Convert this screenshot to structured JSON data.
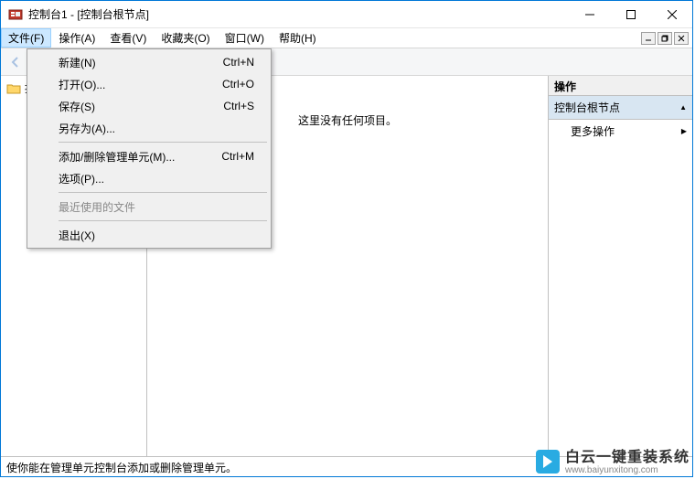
{
  "title": "控制台1 - [控制台根节点]",
  "menubar": {
    "file": "文件(F)",
    "action": "操作(A)",
    "view": "查看(V)",
    "favorites": "收藏夹(O)",
    "window": "窗口(W)",
    "help": "帮助(H)"
  },
  "file_menu": {
    "new": {
      "label": "新建(N)",
      "shortcut": "Ctrl+N"
    },
    "open": {
      "label": "打开(O)...",
      "shortcut": "Ctrl+O"
    },
    "save": {
      "label": "保存(S)",
      "shortcut": "Ctrl+S"
    },
    "save_as": {
      "label": "另存为(A)...",
      "shortcut": ""
    },
    "add_remove": {
      "label": "添加/删除管理单元(M)...",
      "shortcut": "Ctrl+M"
    },
    "options": {
      "label": "选项(P)...",
      "shortcut": ""
    },
    "recent": {
      "label": "最近使用的文件",
      "shortcut": ""
    },
    "exit": {
      "label": "退出(X)",
      "shortcut": ""
    }
  },
  "tree": {
    "root": "控制台根节点"
  },
  "list": {
    "empty": "这里没有任何项目。"
  },
  "actions": {
    "header": "操作",
    "section": "控制台根节点",
    "more": "更多操作"
  },
  "statusbar": "使你能在管理单元控制台添加或删除管理单元。",
  "watermark": {
    "main": "白云一键重装系统",
    "sub": "www.baiyunxitong.com"
  },
  "icons": {
    "app": "app-icon",
    "minimize": "minimize-icon",
    "maximize": "maximize-icon",
    "close": "close-icon",
    "back": "back-icon",
    "forward": "forward-icon",
    "folder": "folder-icon",
    "caret_up": "▲",
    "caret_right": "▶"
  }
}
